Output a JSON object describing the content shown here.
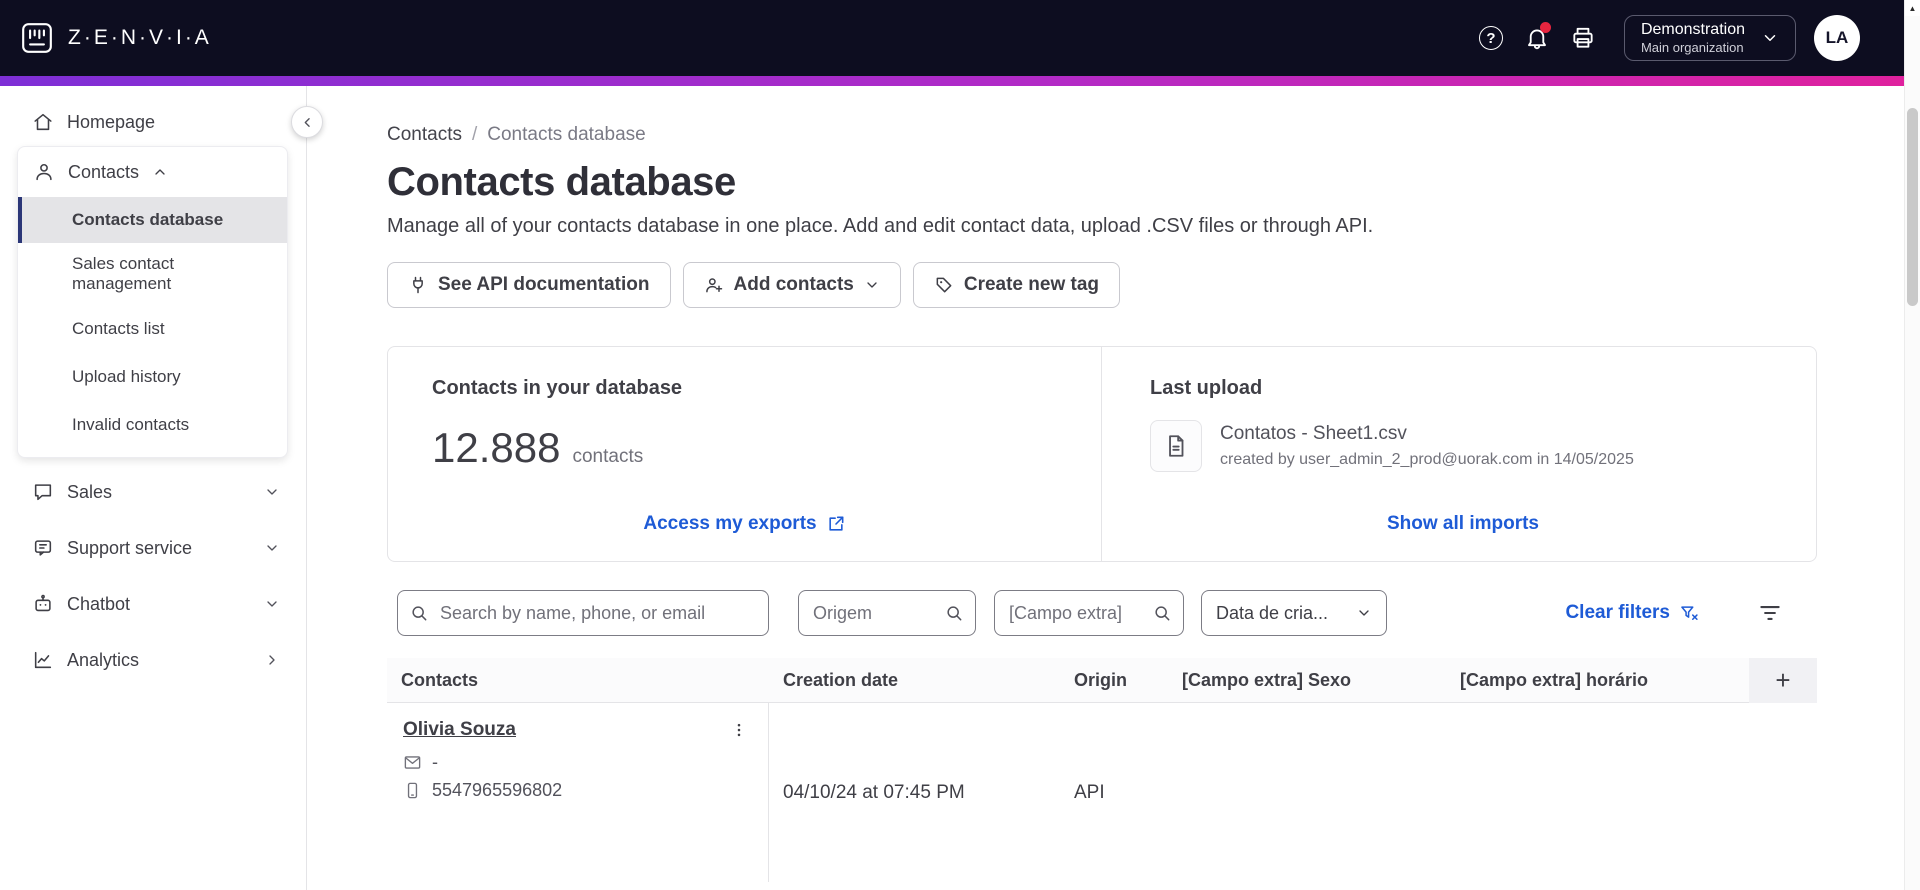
{
  "colors": {
    "header_bg": "#0d0d20",
    "accent": "#1e5bd6",
    "grad_a": "#7e2fd6",
    "grad_b": "#b32ac6",
    "grad_c": "#e0219d",
    "selected_bar": "#2b3677",
    "notif": "#e8253f",
    "border": "#e4e4e7",
    "text_dark": "#3f3f46",
    "text_mid": "#52525b",
    "text_light": "#71717a"
  },
  "glyphs": {
    "help": "?",
    "scroll_up": "▲"
  },
  "header": {
    "brand": "Z·E·N·V·I·A",
    "org": {
      "name": "Demonstration",
      "sub": "Main organization"
    },
    "avatar": "LA"
  },
  "sidebar": {
    "homepage": "Homepage",
    "contacts": {
      "label": "Contacts",
      "children": [
        {
          "label": "Contacts database"
        },
        {
          "label": "Sales contact management"
        },
        {
          "label": "Contacts list"
        },
        {
          "label": "Upload history"
        },
        {
          "label": "Invalid contacts"
        }
      ]
    },
    "items": [
      {
        "label": "Sales"
      },
      {
        "label": "Support service"
      },
      {
        "label": "Chatbot"
      },
      {
        "label": "Analytics"
      }
    ]
  },
  "breadcrumb": {
    "parent": "Contacts",
    "separator": "/",
    "current": "Contacts database"
  },
  "page": {
    "title": "Contacts database",
    "subtitle": "Manage all of your contacts database in one place. Add and edit contact data, upload .CSV files or through API."
  },
  "toolbar": {
    "api_docs": "See API documentation",
    "add_contacts": "Add contacts",
    "create_tag": "Create new tag"
  },
  "stats": {
    "contacts_title": "Contacts in your database",
    "count": "12.888",
    "count_unit": "contacts",
    "exports_link": "Access my exports",
    "last_upload_title": "Last upload",
    "file_name": "Contatos - Sheet1.csv",
    "file_meta": "created by user_admin_2_prod@uorak.com in 14/05/2025",
    "imports_link": "Show all imports"
  },
  "filters": {
    "search_placeholder": "Search by name, phone, or email",
    "origem_placeholder": "Origem",
    "campo_placeholder": "[Campo extra]",
    "date_label": "Data de cria...",
    "clear_label": "Clear filters"
  },
  "table": {
    "headers": [
      "Contacts",
      "Creation date",
      "Origin",
      "[Campo extra] Sexo",
      "[Campo extra] horário"
    ],
    "add_column": "+",
    "rows": [
      {
        "name": "Olivia Souza",
        "email": "-",
        "phone": "5547965596802",
        "creation": "04/10/24 at 07:45 PM",
        "origin": "API"
      }
    ]
  }
}
